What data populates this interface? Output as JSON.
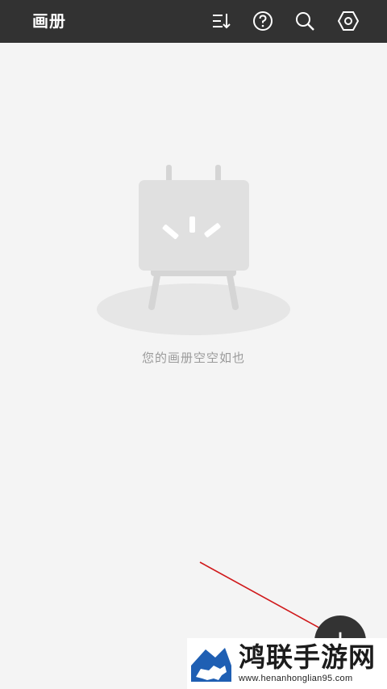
{
  "header": {
    "title": "画册",
    "icons": [
      "sort-icon",
      "help-icon",
      "search-icon",
      "settings-icon"
    ]
  },
  "empty_state": {
    "illustration": "easel-icon",
    "message": "您的画册空空如也"
  },
  "fab": {
    "label": "+",
    "icon": "plus-icon"
  },
  "watermark": {
    "name": "鸿联手游网",
    "url": "www.henanhonglian95.com"
  },
  "colors": {
    "header_bg": "#323232",
    "page_bg": "#f4f4f4",
    "annotation_arrow": "#d0191b",
    "fab_bg": "#333333"
  }
}
